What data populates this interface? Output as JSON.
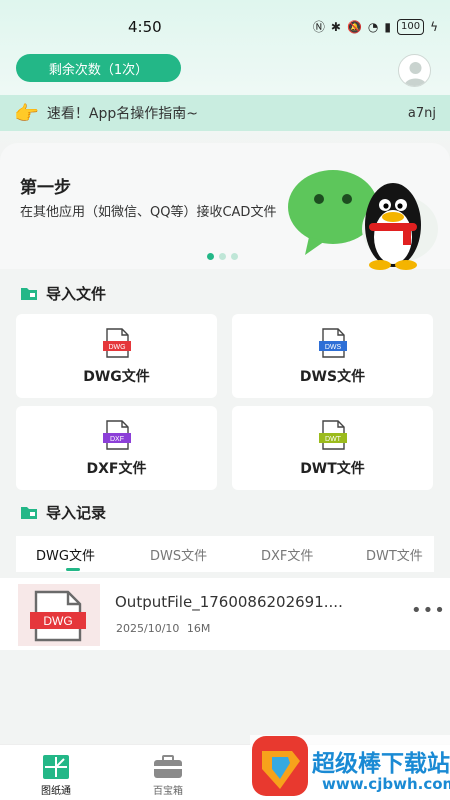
{
  "status_bar": {
    "time": "4:50",
    "battery": "100"
  },
  "header": {
    "count_button": "剩余次数（1次）"
  },
  "notice": {
    "text": "速看！App名操作指南~",
    "code": "a7nj"
  },
  "banner": {
    "step": "第一步",
    "description": "在其他应用（如微信、QQ等）接收CAD文件",
    "page_index": 1,
    "page_count": 3
  },
  "import_section": {
    "title": "导入文件",
    "cards": [
      {
        "label": "DWG文件",
        "tag": "DWG",
        "color": "#e5373b"
      },
      {
        "label": "DWS文件",
        "tag": "DWS",
        "color": "#2e6fd6"
      },
      {
        "label": "DXF文件",
        "tag": "DXF",
        "color": "#8c3fd8"
      },
      {
        "label": "DWT文件",
        "tag": "DWT",
        "color": "#9bbb1c"
      }
    ]
  },
  "records_section": {
    "title": "导入记录",
    "tabs": [
      "DWG文件",
      "DWS文件",
      "DXF文件",
      "DWT文件"
    ],
    "active_tab": 0,
    "files": [
      {
        "name": "OutputFile_1760086202691....",
        "date": "2025/10/10",
        "size": "16M",
        "tag": "DWG"
      }
    ]
  },
  "bottom_nav": {
    "items": [
      {
        "label": "图纸通"
      },
      {
        "label": "百宝箱"
      }
    ]
  },
  "watermark": {
    "text": "超级棒下载站",
    "url": "www.cjbwh.com"
  },
  "colors": {
    "accent": "#23b787"
  }
}
